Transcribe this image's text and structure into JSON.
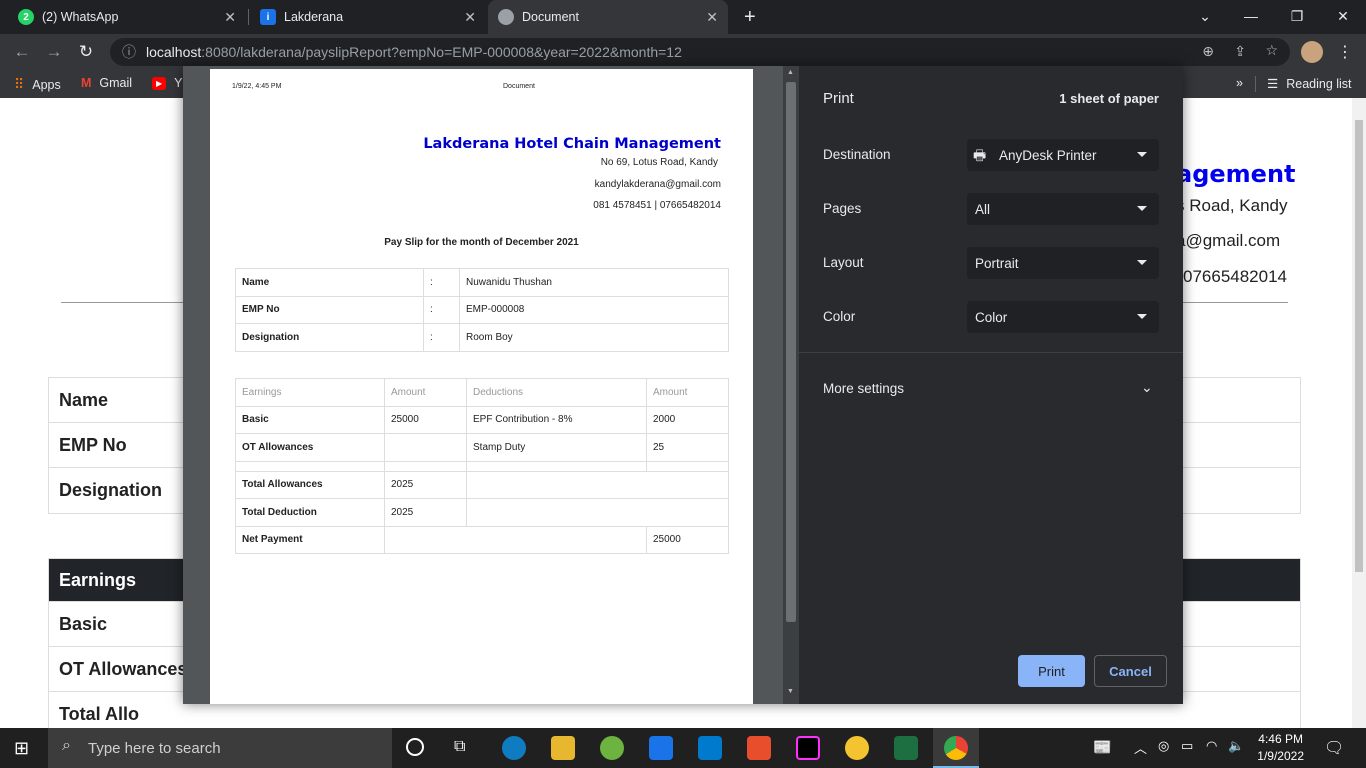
{
  "browser": {
    "tabs": [
      {
        "title": "(2) WhatsApp"
      },
      {
        "title": "Lakderana"
      },
      {
        "title": "Document"
      }
    ],
    "new_tab": "+",
    "url_host": "localhost",
    "url_path": ":8080/lakderana/payslipReport?empNo=EMP-000008&year=2022&month=12",
    "bookmarks": [
      {
        "label": "Apps"
      },
      {
        "label": "Gmail"
      },
      {
        "label": "Y"
      }
    ],
    "more_bookmarks": "»",
    "reading_list": "Reading list"
  },
  "background_page": {
    "title": "agement",
    "address": "s Road, Kandy",
    "email": "a@gmail.com",
    "phone": "07665482014",
    "info_rows": [
      "Name",
      "EMP No",
      "Designation"
    ],
    "pay_header": "Earnings",
    "pay_rows": [
      "Basic",
      "OT Allowances",
      "Total Allo"
    ]
  },
  "preview": {
    "header_date": "1/9/22, 4:45 PM",
    "header_title": "Document",
    "company": "Lakderana Hotel Chain Management",
    "address": "No 69, Lotus Road, Kandy",
    "email": "kandylakderana@gmail.com",
    "phone": "081 4578451 | 07665482014",
    "caption": "Pay Slip for the month of December 2021",
    "info": [
      {
        "label": "Name",
        "sep": ":",
        "value": "Nuwanidu Thushan"
      },
      {
        "label": "EMP No",
        "sep": ":",
        "value": "EMP-000008"
      },
      {
        "label": "Designation",
        "sep": ":",
        "value": "Room Boy"
      }
    ],
    "pay_headers": [
      "Earnings",
      "Amount",
      "Deductions",
      "Amount"
    ],
    "pay_rows": [
      {
        "earning": "Basic",
        "amount": "25000",
        "deduction": "EPF Contribution - 8%",
        "ded_amount": "2000"
      },
      {
        "earning": "OT Allowances",
        "amount": "",
        "deduction": "Stamp Duty",
        "ded_amount": "25"
      }
    ],
    "total_allowances_label": "Total Allowances",
    "total_allowances": "2025",
    "total_deduction_label": "Total Deduction",
    "total_deduction": "2025",
    "net_payment_label": "Net Payment",
    "net_payment": "25000"
  },
  "print_settings": {
    "title": "Print",
    "sheets": "1 sheet of paper",
    "destination_label": "Destination",
    "destination": "AnyDesk Printer",
    "pages_label": "Pages",
    "pages": "All",
    "layout_label": "Layout",
    "layout": "Portrait",
    "color_label": "Color",
    "color": "Color",
    "more_settings": "More settings",
    "print_button": "Print",
    "cancel_button": "Cancel"
  },
  "taskbar": {
    "search_placeholder": "Type here to search",
    "time": "4:46 PM",
    "date": "1/9/2022"
  },
  "colors": {
    "accent": "#8ab4f8",
    "company_blue": "#0000cc",
    "dialog_bg": "#292a2d"
  }
}
